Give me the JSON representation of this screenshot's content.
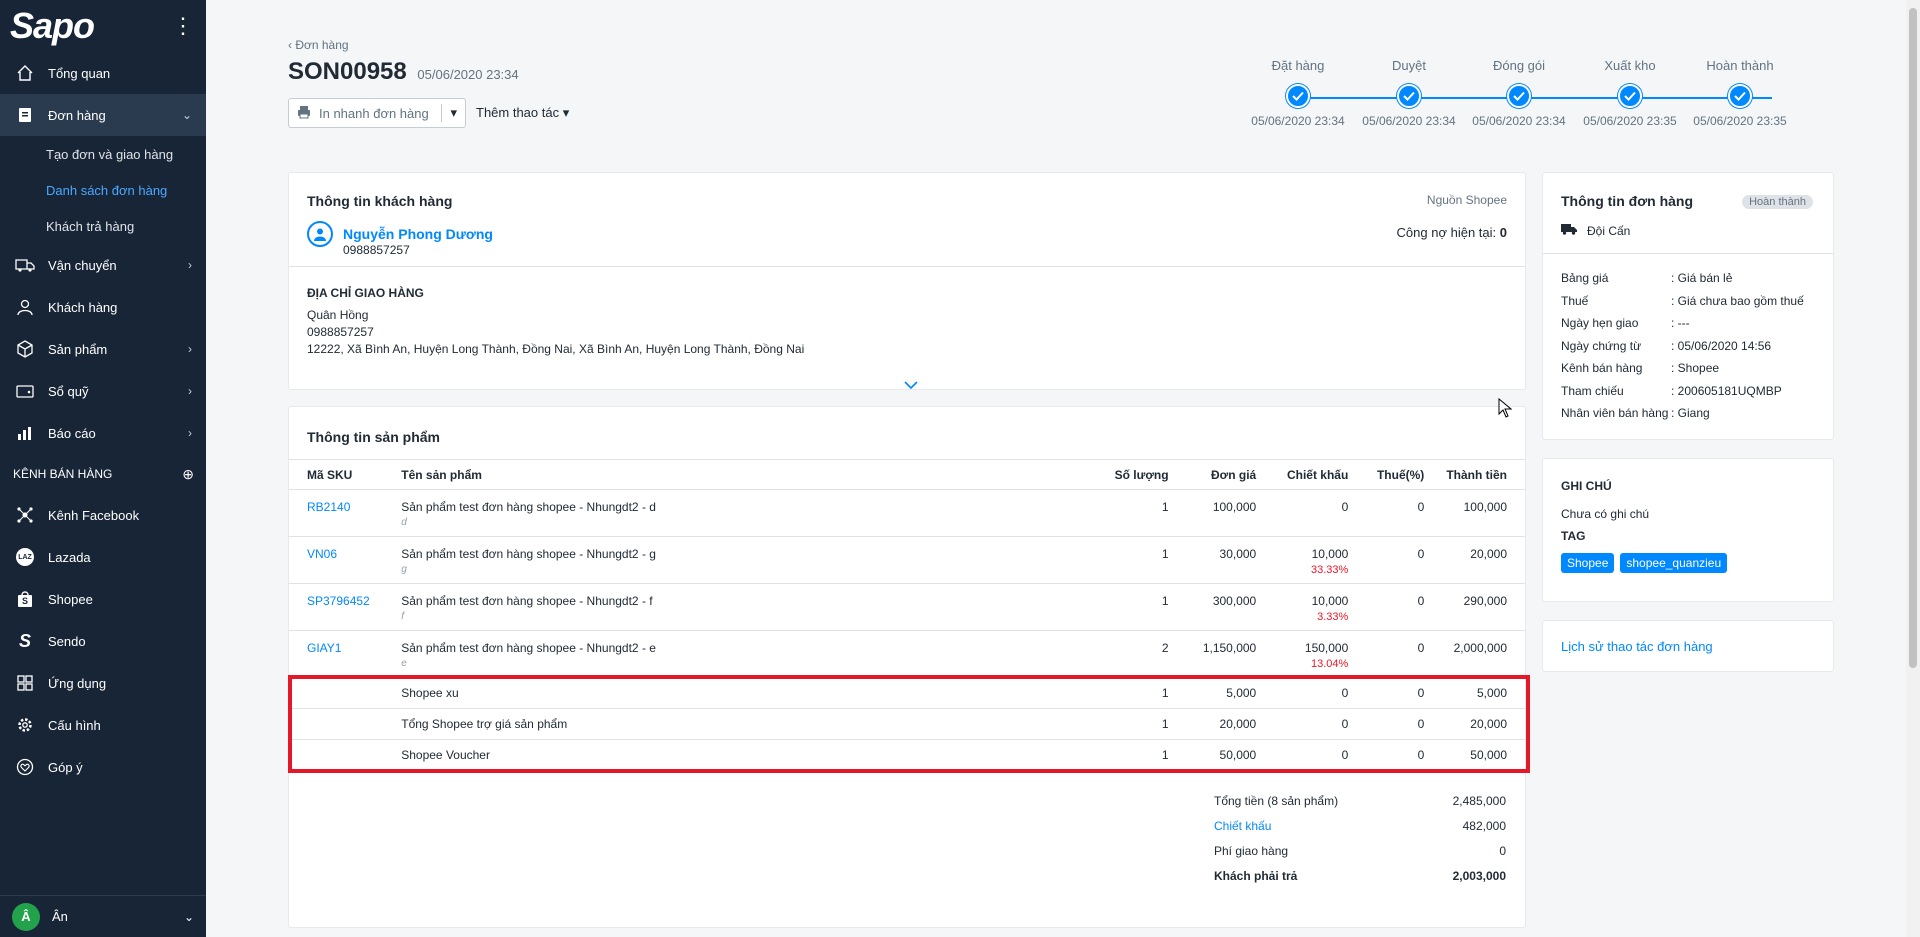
{
  "sidebar": {
    "logo": "Sapo",
    "items": [
      {
        "label": "Tổng quan"
      },
      {
        "label": "Đơn hàng"
      },
      {
        "label": "Vận chuyển"
      },
      {
        "label": "Khách hàng"
      },
      {
        "label": "Sản phẩm"
      },
      {
        "label": "Sổ quỹ"
      },
      {
        "label": "Báo cáo"
      }
    ],
    "sub_items": [
      {
        "label": "Tạo đơn và giao hàng"
      },
      {
        "label": "Danh sách đơn hàng"
      },
      {
        "label": "Khách trả hàng"
      }
    ],
    "channels_label": "KÊNH BÁN HÀNG",
    "channels": [
      {
        "label": "Kênh Facebook"
      },
      {
        "label": "Lazada"
      },
      {
        "label": "Shopee"
      },
      {
        "label": "Sendo"
      }
    ],
    "bottom_items": [
      {
        "label": "Ứng dụng"
      },
      {
        "label": "Cấu hình"
      },
      {
        "label": "Góp ý"
      }
    ],
    "user": {
      "initial": "Â",
      "name": "Ân"
    }
  },
  "header": {
    "breadcrumb": "Đơn hàng",
    "order_code": "SON00958",
    "order_date": "05/06/2020 23:34",
    "print_label": "In nhanh đơn hàng",
    "more_actions": "Thêm thao tác"
  },
  "steps": [
    {
      "label": "Đặt hàng",
      "date": "05/06/2020 23:34"
    },
    {
      "label": "Duyệt",
      "date": "05/06/2020 23:34"
    },
    {
      "label": "Đóng gói",
      "date": "05/06/2020 23:34"
    },
    {
      "label": "Xuất kho",
      "date": "05/06/2020 23:35"
    },
    {
      "label": "Hoàn thành",
      "date": "05/06/2020 23:35"
    }
  ],
  "customer": {
    "title": "Thông tin khách hàng",
    "source": "Nguồn Shopee",
    "name": "Nguyễn Phong Dương",
    "phone": "0988857257",
    "debt_label": "Công nợ hiện tại:",
    "debt_value": "0",
    "address_title": "ĐỊA CHỈ GIAO HÀNG",
    "address_name": "Quân Hồng",
    "address_phone": "0988857257",
    "address_line": "12222, Xã Bình An, Huyện Long Thành, Đồng Nai, Xã Bình An, Huyện Long Thành, Đồng Nai"
  },
  "products": {
    "title": "Thông tin sản phẩm",
    "columns": [
      "Mã SKU",
      "Tên sản phẩm",
      "Số lượng",
      "Đơn giá",
      "Chiết khấu",
      "Thuế(%)",
      "Thành tiền"
    ],
    "rows": [
      {
        "sku": "RB2140",
        "name": "Sản phẩm test đơn hàng shopee - Nhungdt2 - d",
        "variant": "d",
        "qty": "1",
        "price": "100,000",
        "discount": "0",
        "discount_pct": "",
        "tax": "0",
        "total": "100,000"
      },
      {
        "sku": "VN06",
        "name": "Sản phẩm test đơn hàng shopee - Nhungdt2 - g",
        "variant": "g",
        "qty": "1",
        "price": "30,000",
        "discount": "10,000",
        "discount_pct": "33.33%",
        "tax": "0",
        "total": "20,000"
      },
      {
        "sku": "SP3796452",
        "name": "Sản phẩm test đơn hàng shopee - Nhungdt2 - f",
        "variant": "f",
        "qty": "1",
        "price": "300,000",
        "discount": "10,000",
        "discount_pct": "3.33%",
        "tax": "0",
        "total": "290,000"
      },
      {
        "sku": "GIAY1",
        "name": "Sản phẩm test đơn hàng shopee - Nhungdt2 - e",
        "variant": "e",
        "qty": "2",
        "price": "1,150,000",
        "discount": "150,000",
        "discount_pct": "13.04%",
        "tax": "0",
        "total": "2,000,000"
      }
    ],
    "extra_rows": [
      {
        "name": "Shopee xu",
        "qty": "1",
        "price": "5,000",
        "discount": "0",
        "tax": "0",
        "total": "5,000"
      },
      {
        "name": "Tổng Shopee trợ giá sản phẩm",
        "qty": "1",
        "price": "20,000",
        "discount": "0",
        "tax": "0",
        "total": "20,000"
      },
      {
        "name": "Shopee Voucher",
        "qty": "1",
        "price": "50,000",
        "discount": "0",
        "tax": "0",
        "total": "50,000"
      }
    ],
    "totals": [
      {
        "label": "Tổng tiền (8 sản phẩm)",
        "value": "2,485,000"
      },
      {
        "label": "Chiết khấu",
        "value": "482,000"
      },
      {
        "label": "Phí giao hàng",
        "value": "0"
      },
      {
        "label": "Khách phải trả",
        "value": "2,003,000"
      }
    ]
  },
  "order_info": {
    "title": "Thông tin đơn hàng",
    "status": "Hoàn thành",
    "store": "Đội Cấn",
    "rows": [
      {
        "k": "Bảng giá",
        "v": ": Giá bán lẻ"
      },
      {
        "k": "Thuế",
        "v": ": Giá chưa bao gồm thuế"
      },
      {
        "k": "Ngày hẹn giao",
        "v": ": ---"
      },
      {
        "k": "Ngày chứng từ",
        "v": ": 05/06/2020 14:56"
      },
      {
        "k": "Kênh bán hàng",
        "v": ": Shopee"
      },
      {
        "k": "Tham chiếu",
        "v": ": 200605181UQMBP"
      },
      {
        "k": "Nhân viên bán hàng",
        "v": ": Giang"
      }
    ]
  },
  "notes": {
    "title": "GHI CHÚ",
    "empty": "Chưa có ghi chú",
    "tag_title": "TAG",
    "tags": [
      "Shopee",
      "shopee_quanzieu"
    ]
  },
  "history_link": "Lịch sử thao tác đơn hàng",
  "colors": {
    "primary": "#0088ff",
    "sidebar": "#182537",
    "danger": "#e3192a"
  }
}
